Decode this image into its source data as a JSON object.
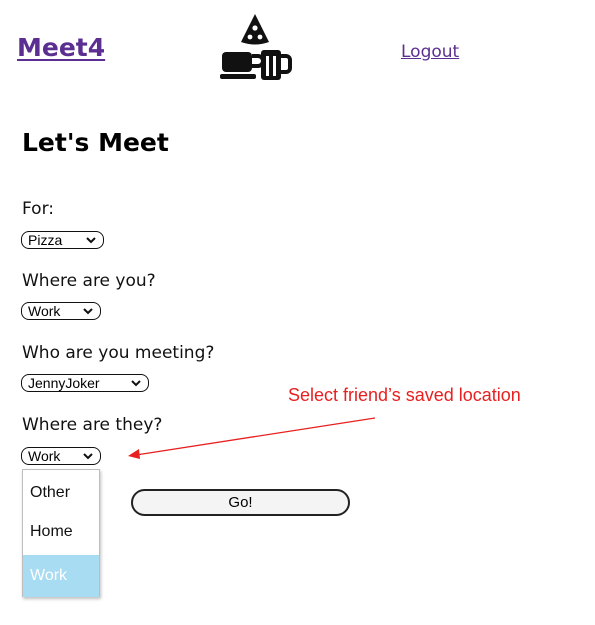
{
  "header": {
    "brand": "Meet4",
    "logo_icon": "pizza-coffee-beer-icon",
    "logout": "Logout"
  },
  "form": {
    "title": "Let's Meet",
    "for_label": "For:",
    "for_value": "Pizza",
    "where_you_label": "Where are you?",
    "where_you_value": "Work",
    "who_label": "Who are you meeting?",
    "who_value": "JennyJoker",
    "where_they_label": "Where are they?",
    "where_they_value": "Work",
    "go_label": "Go!"
  },
  "dropdown": {
    "options": [
      "Other",
      "Home",
      "Work"
    ],
    "selected": "Work"
  },
  "annotation": {
    "text": "Select friend’s saved location",
    "color": "#e82020"
  },
  "colors": {
    "link": "#5b2f91",
    "highlight": "#a8dcf2"
  }
}
